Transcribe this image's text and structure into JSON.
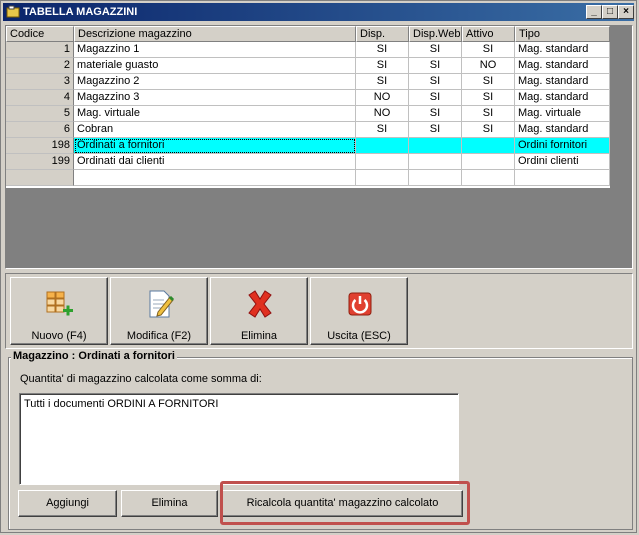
{
  "window": {
    "title": "TABELLA MAGAZZINI"
  },
  "titlebar_buttons": {
    "minimize": "_",
    "maximize": "□",
    "close": "×"
  },
  "table": {
    "headers": [
      "Codice",
      "Descrizione magazzino",
      "Disp.",
      "Disp.Web",
      "Attivo",
      "Tipo"
    ],
    "rows": [
      [
        "1",
        "Magazzino 1",
        "SI",
        "SI",
        "SI",
        "Mag. standard"
      ],
      [
        "2",
        "materiale guasto",
        "SI",
        "SI",
        "NO",
        "Mag. standard"
      ],
      [
        "3",
        "Magazzino 2",
        "SI",
        "SI",
        "SI",
        "Mag. standard"
      ],
      [
        "4",
        "Magazzino 3",
        "NO",
        "SI",
        "SI",
        "Mag. standard"
      ],
      [
        "5",
        "Mag. virtuale",
        "NO",
        "SI",
        "SI",
        "Mag. virtuale"
      ],
      [
        "6",
        "Cobran",
        "SI",
        "SI",
        "SI",
        "Mag. standard"
      ],
      [
        "198",
        "Ordinati a fornitori",
        "",
        "",
        "",
        "Ordini fornitori"
      ],
      [
        "199",
        "Ordinati dai clienti",
        "",
        "",
        "",
        "Ordini clienti"
      ],
      [
        "",
        "",
        "",
        "",
        "",
        ""
      ]
    ],
    "selected_row": 6,
    "selection_color": "#00ffff"
  },
  "toolbar": {
    "new_label": "Nuovo (F4)",
    "edit_label": "Modifica (F2)",
    "delete_label": "Elimina",
    "exit_label": "Uscita (ESC)"
  },
  "detail": {
    "group_title": "Magazzino : Ordinati a fornitori",
    "subtitle": "Quantita' di magazzino calcolata come somma di:",
    "list_items": [
      "Tutti i documenti ORDINI A FORNITORI"
    ],
    "add_label": "Aggiungi",
    "delete_label": "Elimina",
    "recalc_label": "Ricalcola quantita' magazzino calcolato"
  },
  "accent_colors": {
    "titlebar": "#0a246a",
    "highlight_box": "#c0504d"
  }
}
